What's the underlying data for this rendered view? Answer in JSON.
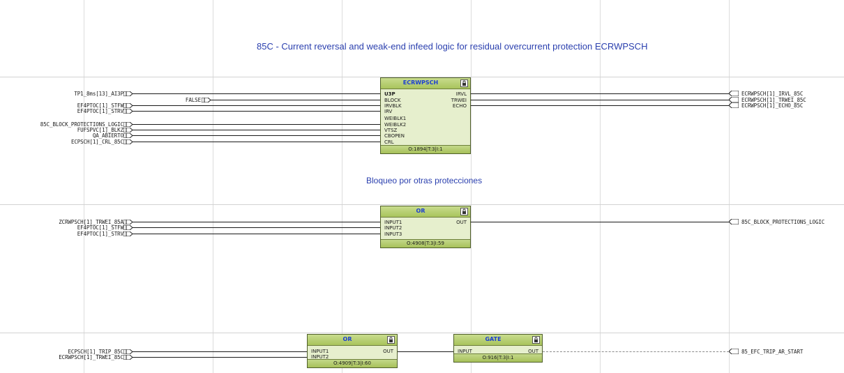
{
  "titles": {
    "main": "85C - Current reversal and weak-end infeed logic for residual overcurrent protection ECRWPSCH",
    "section2": "Bloqueo por otras protecciones"
  },
  "blocks": {
    "ecrwpsch": {
      "name": "ECRWPSCH",
      "footer": "O:1894|T:3|I:1",
      "inputs": [
        "U3P",
        "BLOCK",
        "IRVBLK",
        "IRV",
        "WEIBLK1",
        "WEIBLK2",
        "VTSZ",
        "CBOPEN",
        "CRL"
      ],
      "outputs": [
        "IRVL",
        "TRWEI",
        "ECHO"
      ]
    },
    "or1": {
      "name": "OR",
      "footer": "O:4908|T:3|I:59",
      "inputs": [
        "INPUT1",
        "INPUT2",
        "INPUT3"
      ],
      "outputs": [
        "OUT"
      ]
    },
    "or2": {
      "name": "OR",
      "footer": "O:4909|T:3|I:60",
      "inputs": [
        "INPUT1",
        "INPUT2"
      ],
      "outputs": [
        "OUT"
      ]
    },
    "gate": {
      "name": "GATE",
      "footer": "O:916|T:3|I:1",
      "inputs": [
        "INPUT"
      ],
      "outputs": [
        "OUT"
      ]
    }
  },
  "signals": {
    "in1": [
      "TP1_8ms[13]_AI3P",
      "FALSE",
      "EF4PTOC[1]_STFW",
      "EF4PTOC[1]_STRV",
      "85C_BLOCK_PROTECTIONS_LOGIC",
      "FUFSPVC[1]_BLKZ",
      "QA_ABIERTO",
      "ECPSCH[1]_CRL_85C"
    ],
    "out1": [
      "ECRWPSCH[1]_IRVL_85C",
      "ECRWPSCH[1]_TRWEI_85C",
      "ECRWPSCH[1]_ECHO_85C"
    ],
    "in2": [
      "ZCRWPSCH[1]_TRWEI_85A",
      "EF4PTOC[1]_STFW",
      "EF4PTOC[1]_STRV"
    ],
    "out2": [
      "85C_BLOCK_PROTECTIONS_LOGIC"
    ],
    "in3": [
      "ECPSCH[1]_TRIP_85C",
      "ECRWPSCH[1]_TRWEI_85C"
    ],
    "out3": [
      "85_EFC_TRIP_AR_START"
    ]
  },
  "colors": {
    "title": "#2a3fae",
    "block_fill": "#e6efcd",
    "block_header": "#a9c45c",
    "block_name": "#1b3fd1",
    "grid": "#dcdcdc"
  }
}
